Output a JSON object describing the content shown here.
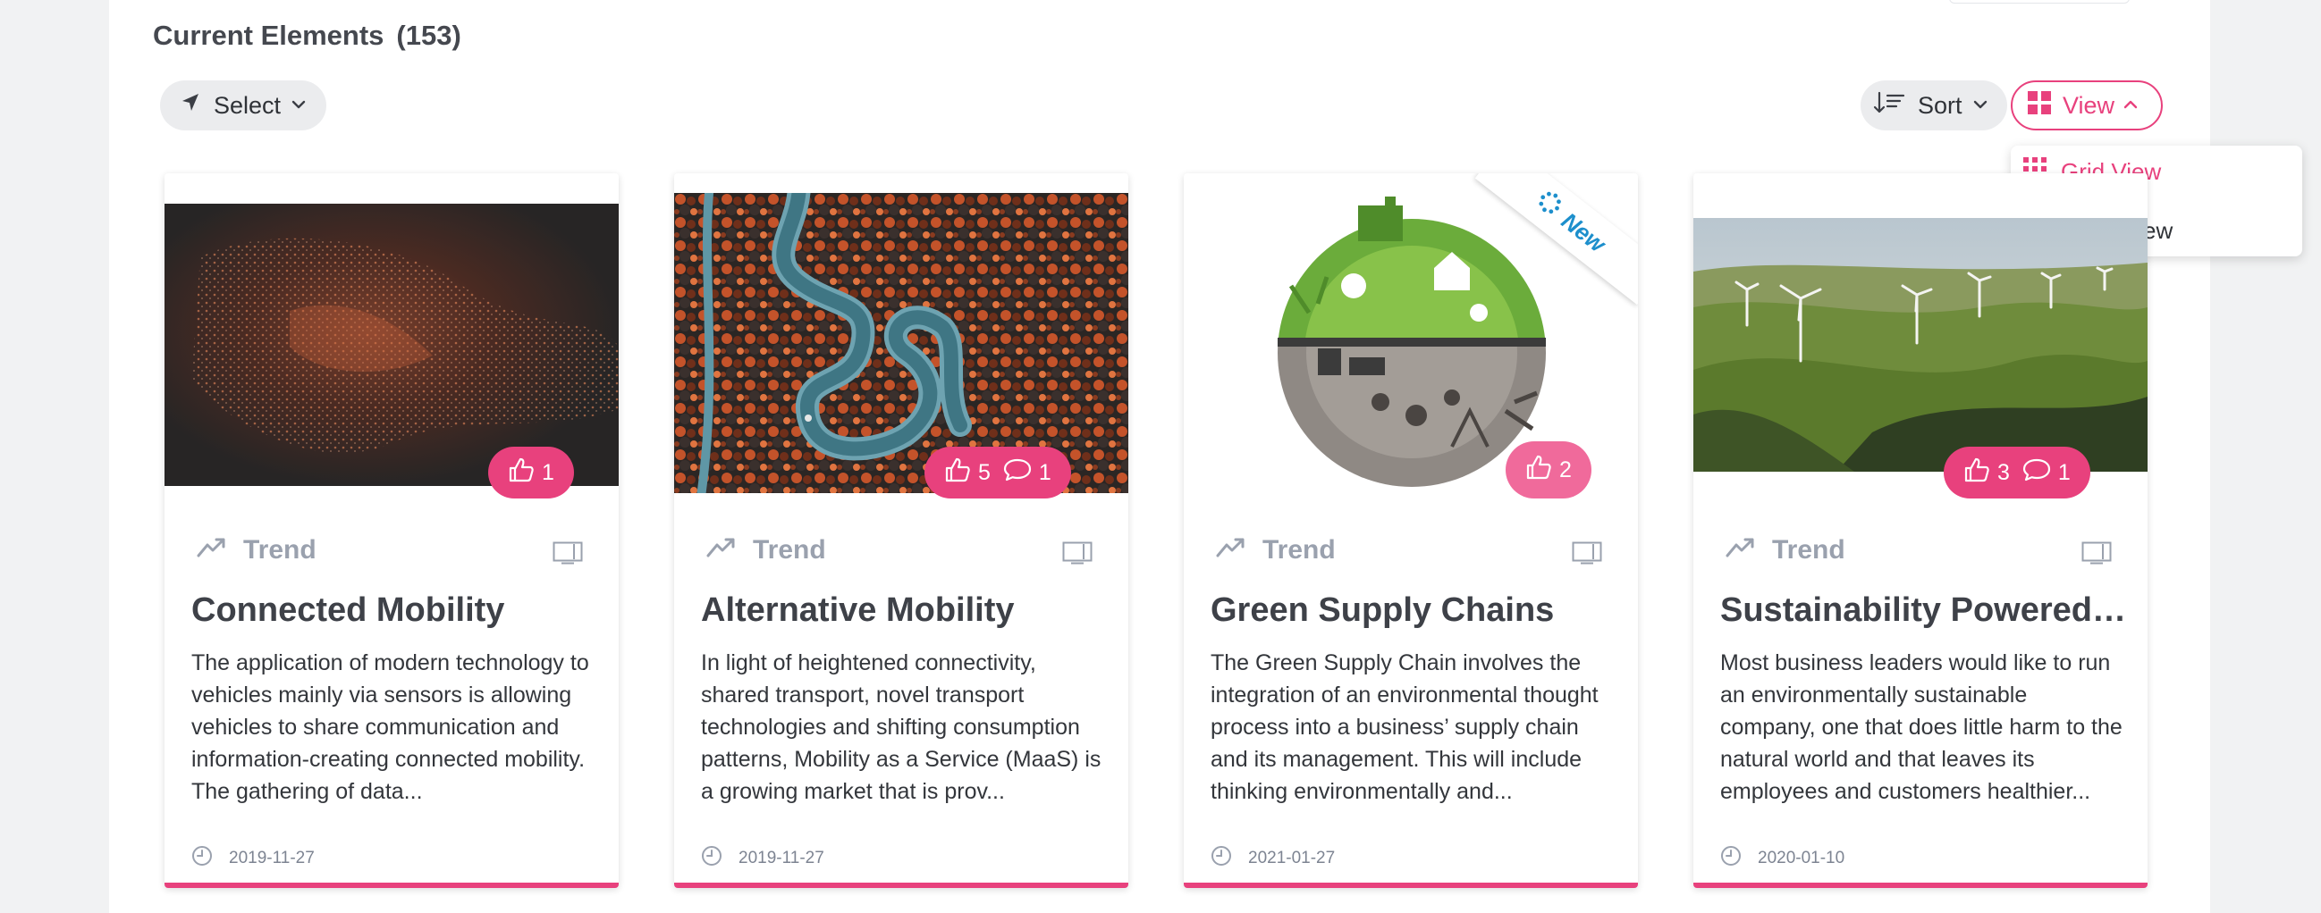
{
  "header": {
    "title": "Current Elements",
    "count": "(153)"
  },
  "toolbar": {
    "select_label": "Select",
    "sort_label": "Sort",
    "view_label": "View"
  },
  "view_menu": {
    "items": [
      {
        "label": "Grid View",
        "icon": "grid-icon",
        "selected": true
      },
      {
        "label": "Table View",
        "icon": "list-icon",
        "selected": false
      }
    ]
  },
  "colors": {
    "accent": "#e8417d",
    "new_badge": "#1d8fcc",
    "muted": "#9aa1ae"
  },
  "cards": [
    {
      "type": "Trend",
      "title": "Connected Mobility",
      "description": "The application of modern technology to vehicles mainly via sensors is allowing vehicles to share communication and information-creating connected mobility. The gathering of data...",
      "date": "2019-11-27",
      "likes": "1",
      "comments": null,
      "image": "night-city-aerial"
    },
    {
      "type": "Trend",
      "title": "Alternative Mobility",
      "description": "In light of heightened connectivity, shared transport, novel transport technologies and shifting consumption patterns, Mobility as a Service (MaaS) is a growing market that is prov...",
      "date": "2019-11-27",
      "likes": "5",
      "comments": "1",
      "image": "winding-road-forest"
    },
    {
      "type": "Trend",
      "title": "Green Supply Chains",
      "description": "The Green Supply Chain involves the integration of an environmental thought process into a business’ supply chain and its management. This will include thinking environmentally and...",
      "date": "2021-01-27",
      "likes": "2",
      "comments": null,
      "badge": "New",
      "image": "green-globe-illustration"
    },
    {
      "type": "Trend",
      "title": "Sustainability Powered ...",
      "description": "Most business leaders would like to run an environmentally sustainable company, one that does little harm to the natural world and that leaves its employees and customers healthier...",
      "date": "2020-01-10",
      "likes": "3",
      "comments": "1",
      "image": "wind-farm-hills"
    }
  ]
}
